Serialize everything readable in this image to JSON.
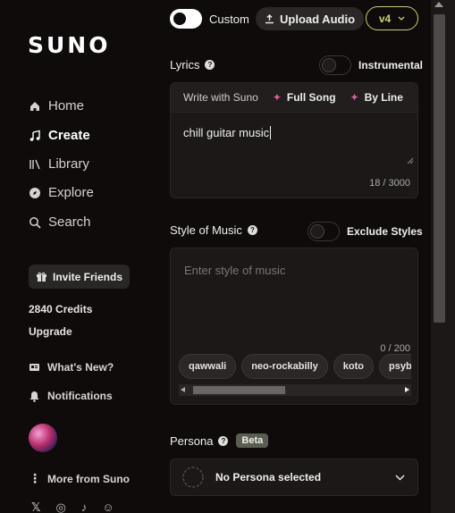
{
  "sidebar": {
    "logo": "SUNO",
    "nav": [
      {
        "label": "Home",
        "icon": "home-icon"
      },
      {
        "label": "Create",
        "icon": "music-note-icon"
      },
      {
        "label": "Library",
        "icon": "library-icon"
      },
      {
        "label": "Explore",
        "icon": "compass-icon"
      },
      {
        "label": "Search",
        "icon": "search-icon"
      }
    ],
    "invite_label": "Invite Friends",
    "credits": "2840 Credits",
    "upgrade": "Upgrade",
    "whats_new": "What's New?",
    "notifications": "Notifications",
    "more_from": "More from Suno",
    "social": [
      "X",
      "IG",
      "TT",
      "DC"
    ]
  },
  "top_bar": {
    "custom_label": "Custom",
    "custom_on": true,
    "upload_label": "Upload Audio",
    "version": "v4"
  },
  "lyrics": {
    "label": "Lyrics",
    "instrumental_label": "Instrumental",
    "instrumental_on": false,
    "write_with": "Write with Suno",
    "full_song": "Full Song",
    "by_line": "By Line",
    "value": "chill guitar music",
    "counter": "18 / 3000"
  },
  "style": {
    "label": "Style of Music",
    "exclude_label": "Exclude Styles",
    "exclude_on": false,
    "placeholder": "Enter style of music",
    "counter": "0 / 200",
    "tags": [
      "qawwali",
      "neo-rockabilly",
      "koto",
      "psybas"
    ]
  },
  "persona": {
    "label": "Persona",
    "badge": "Beta",
    "selected": "No Persona selected"
  },
  "colors": {
    "accent_pink": "#e25c9c",
    "version_green": "#c3d36a",
    "background": "#0f0b0b"
  }
}
